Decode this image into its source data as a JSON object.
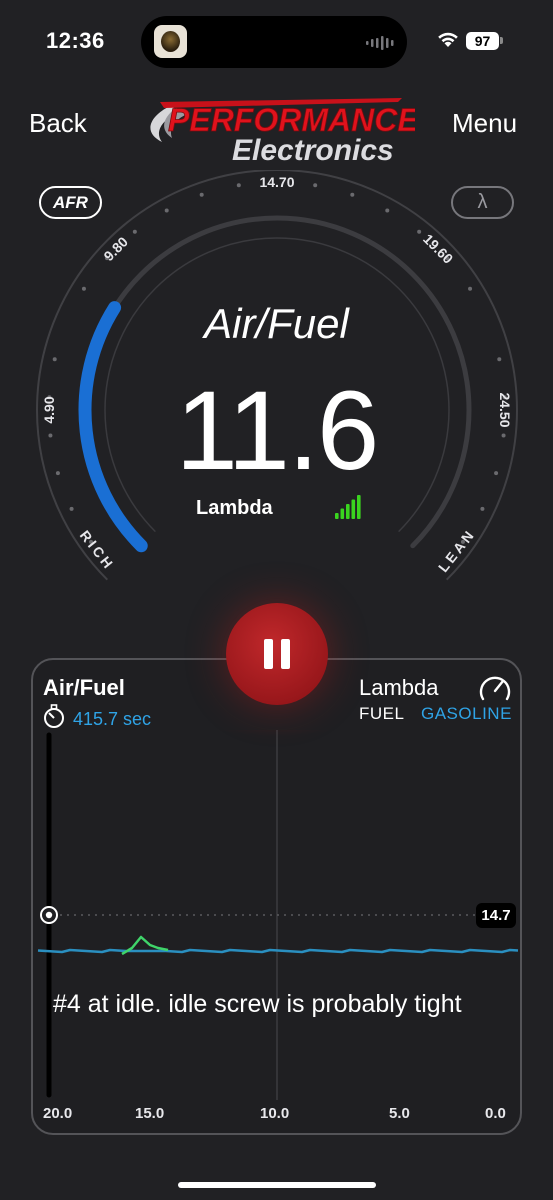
{
  "status_bar": {
    "time": "12:36",
    "battery": "97"
  },
  "header": {
    "back_label": "Back",
    "menu_label": "Menu",
    "logo_line1": "PERFORMANCE",
    "logo_line2": "Electronics"
  },
  "gauge": {
    "mode_afr": "AFR",
    "mode_lambda": "λ",
    "title": "Air/Fuel",
    "value": "11.6",
    "unit_label": "Lambda",
    "ticks": [
      "4.90",
      "9.80",
      "14.70",
      "19.60",
      "24.50"
    ],
    "rich_label": "RICH",
    "lean_label": "LEAN",
    "arc_min": 4.9,
    "arc_max": 24.5,
    "fill_value": 11.6,
    "signal_bars": 4,
    "colors": {
      "arc": "#1a6fd4",
      "signal": "#3ad41f",
      "pause": "#b01e22"
    }
  },
  "chart": {
    "title": "Air/Fuel",
    "elapsed": "415.7 sec",
    "right_title": "Lambda",
    "fuel_label": "FUEL",
    "fuel_value": "GASOLINE",
    "target_value": "14.7",
    "annotation": "#4 at idle. idle screw is probably tight",
    "x_ticks": [
      "20.0",
      "15.0",
      "10.0",
      "5.0",
      "0.0"
    ],
    "colors": {
      "line": "#2a8fc0",
      "spike": "#3fd46a",
      "accent": "#2fa3e6"
    }
  }
}
